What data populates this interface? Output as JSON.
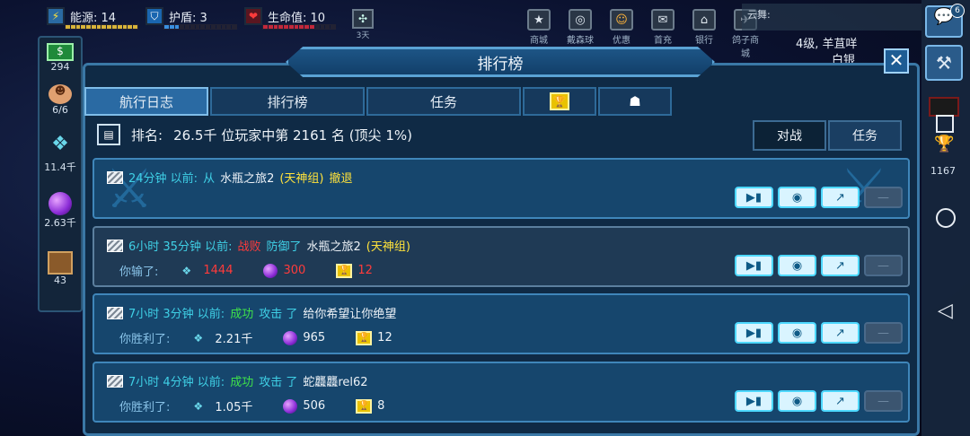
{
  "top": {
    "energy_label": "能源: 14",
    "shield_label": "护盾: 3",
    "life_label": "生命值: 10",
    "days_label": "3天",
    "nav": [
      "商城",
      "戴森球",
      "优惠",
      "首充",
      "银行",
      "鸽子商城"
    ],
    "chat_label": "云舞:",
    "badge": "6"
  },
  "left": {
    "credits": "294",
    "crew": "6/6",
    "gems": "11.4千",
    "orbs": "2.63千",
    "boxes": "43"
  },
  "right": {
    "score": "1167",
    "player_info": "4级, 羊苴咩",
    "rank_label": "白银"
  },
  "panel": {
    "title": "排行榜",
    "tabs": [
      "航行日志",
      "排行榜",
      "任务"
    ],
    "rank_prefix": "排名:",
    "rank_text": "26.5千 位玩家中第 2161 名 (顶尖 1%)",
    "seg_battle": "对战",
    "seg_task": "任务"
  },
  "entries": [
    {
      "time": "24分钟 以前:",
      "verb": "从",
      "target": "水瓶之旅2",
      "group": "(天神组)",
      "action": "撤退",
      "result": "",
      "gems": "",
      "orbs": "",
      "trophies": ""
    },
    {
      "time": "6小时 35分钟 以前:",
      "status": "战败",
      "verb": "防御了",
      "target": "水瓶之旅2",
      "group": "(天神组)",
      "result": "你输了:",
      "gems": "1444",
      "orbs": "300",
      "trophies": "12"
    },
    {
      "time": "7小时 3分钟 以前:",
      "status": "成功",
      "verb": "攻击 了",
      "target": "给你希望让你绝望",
      "result": "你胜利了:",
      "gems": "2.21千",
      "orbs": "965",
      "trophies": "12"
    },
    {
      "time": "7小时 4分钟 以前:",
      "status": "成功",
      "verb": "攻击 了",
      "target": "蛇龘龘rel62",
      "result": "你胜利了:",
      "gems": "1.05千",
      "orbs": "506",
      "trophies": "8"
    }
  ],
  "icons": {
    "video": "video-icon",
    "view": "eye-icon",
    "share": "share-icon",
    "attack": "sword-icon"
  }
}
